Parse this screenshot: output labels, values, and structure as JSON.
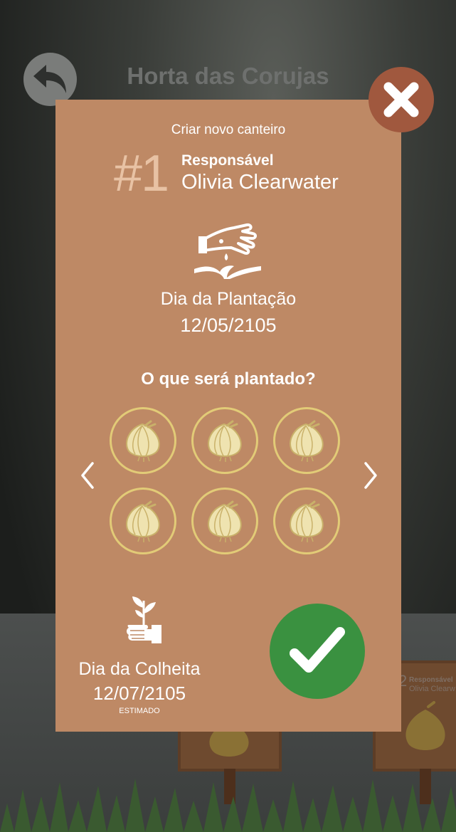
{
  "header": {
    "title": "Horta das Corujas",
    "back_icon": "back-arrow-icon"
  },
  "background_sign": {
    "label": "Responsável",
    "name": "Olivia Clearw",
    "number": "2"
  },
  "modal": {
    "subtitle": "Criar novo canteiro",
    "number": "#1",
    "responsible_label": "Responsável",
    "responsible_name": "Olivia Clearwater",
    "planting_icon": "sowing-hand-icon",
    "planting_label": "Dia da Plantação",
    "planting_date": "12/05/2105",
    "question": "O que será plantado?",
    "seeds": [
      "onion-icon",
      "onion-icon",
      "onion-icon",
      "onion-icon",
      "onion-icon",
      "onion-icon"
    ],
    "harvest_icon": "hand-holding-sprout-icon",
    "harvest_label": "Dia da Colheita",
    "harvest_date": "12/07/2105",
    "harvest_note": "ESTIMADO"
  },
  "colors": {
    "modal": "#be8965",
    "close": "#a0583e",
    "confirm": "#3a9140",
    "seed_ring": "#e2cb77",
    "number": "#e8c2a4"
  }
}
